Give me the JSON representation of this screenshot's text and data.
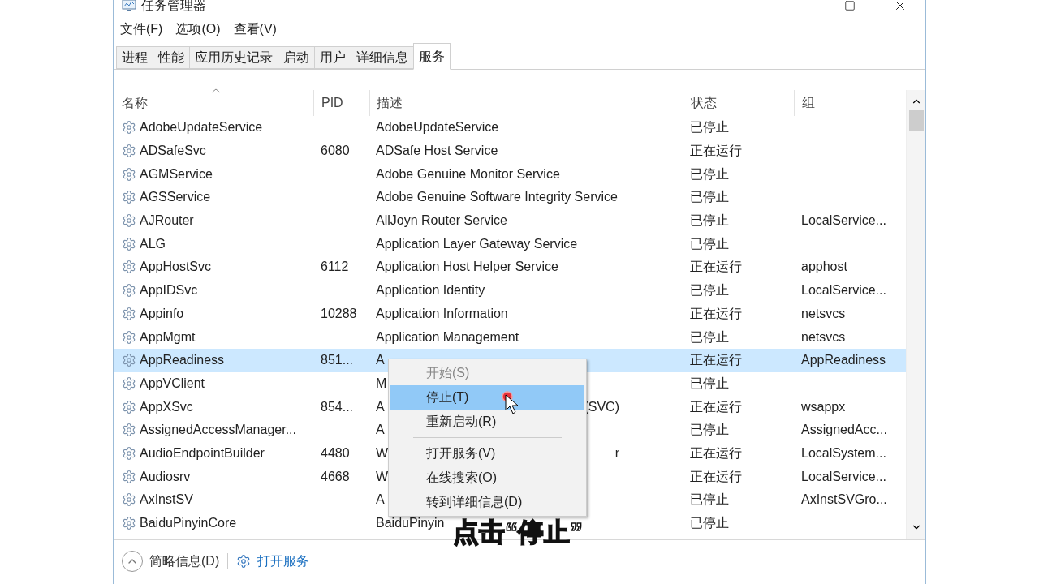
{
  "window": {
    "title": "任务管理器"
  },
  "menu": [
    "文件(F)",
    "选项(O)",
    "查看(V)"
  ],
  "tabs": [
    {
      "label": "进程",
      "selected": false
    },
    {
      "label": "性能",
      "selected": false
    },
    {
      "label": "应用历史记录",
      "selected": false
    },
    {
      "label": "启动",
      "selected": false
    },
    {
      "label": "用户",
      "selected": false
    },
    {
      "label": "详细信息",
      "selected": false
    },
    {
      "label": "服务",
      "selected": true
    }
  ],
  "table": {
    "columns": [
      "名称",
      "PID",
      "描述",
      "状态",
      "组"
    ],
    "rows": [
      {
        "name": "AdobeUpdateService",
        "pid": "",
        "desc": "AdobeUpdateService",
        "status": "已停止",
        "group": "",
        "selected": false
      },
      {
        "name": "ADSafeSvc",
        "pid": "6080",
        "desc": "ADSafe Host Service",
        "status": "正在运行",
        "group": "",
        "selected": false
      },
      {
        "name": "AGMService",
        "pid": "",
        "desc": "Adobe Genuine Monitor Service",
        "status": "已停止",
        "group": "",
        "selected": false
      },
      {
        "name": "AGSService",
        "pid": "",
        "desc": "Adobe Genuine Software Integrity Service",
        "status": "已停止",
        "group": "",
        "selected": false
      },
      {
        "name": "AJRouter",
        "pid": "",
        "desc": "AllJoyn Router Service",
        "status": "已停止",
        "group": "LocalService...",
        "selected": false
      },
      {
        "name": "ALG",
        "pid": "",
        "desc": "Application Layer Gateway Service",
        "status": "已停止",
        "group": "",
        "selected": false
      },
      {
        "name": "AppHostSvc",
        "pid": "6112",
        "desc": "Application Host Helper Service",
        "status": "正在运行",
        "group": "apphost",
        "selected": false
      },
      {
        "name": "AppIDSvc",
        "pid": "",
        "desc": "Application Identity",
        "status": "已停止",
        "group": "LocalService...",
        "selected": false
      },
      {
        "name": "Appinfo",
        "pid": "10288",
        "desc": "Application Information",
        "status": "正在运行",
        "group": "netsvcs",
        "selected": false
      },
      {
        "name": "AppMgmt",
        "pid": "",
        "desc": "Application Management",
        "status": "已停止",
        "group": "netsvcs",
        "selected": false
      },
      {
        "name": "AppReadiness",
        "pid": "851...",
        "desc": "A",
        "status": "正在运行",
        "group": "AppReadiness",
        "selected": true
      },
      {
        "name": "AppVClient",
        "pid": "",
        "desc": "M",
        "status": "已停止",
        "group": "",
        "selected": false
      },
      {
        "name": "AppXSvc",
        "pid": "854...",
        "desc": "A",
        "desc_tail": "(SVC)",
        "status": "正在运行",
        "group": "wsappx",
        "selected": false
      },
      {
        "name": "AssignedAccessManager...",
        "pid": "",
        "desc": "A",
        "status": "已停止",
        "group": "AssignedAcc...",
        "selected": false
      },
      {
        "name": "AudioEndpointBuilder",
        "pid": "4480",
        "desc": "W",
        "desc_tail": "r",
        "status": "正在运行",
        "group": "LocalSystem...",
        "selected": false
      },
      {
        "name": "Audiosrv",
        "pid": "4668",
        "desc": "W",
        "status": "正在运行",
        "group": "LocalService...",
        "selected": false
      },
      {
        "name": "AxInstSV",
        "pid": "",
        "desc": "A",
        "status": "已停止",
        "group": "AxInstSVGro...",
        "selected": false
      },
      {
        "name": "BaiduPinyinCore",
        "pid": "",
        "desc": "BaiduPinyin",
        "status": "已停止",
        "group": "",
        "selected": false
      }
    ]
  },
  "context_menu": [
    {
      "label": "开始(S)",
      "disabled": true,
      "selected": false
    },
    {
      "label": "停止(T)",
      "disabled": false,
      "selected": true
    },
    {
      "label": "重新启动(R)",
      "disabled": false,
      "selected": false,
      "separator_after": true
    },
    {
      "label": "打开服务(V)",
      "disabled": false,
      "selected": false
    },
    {
      "label": "在线搜索(O)",
      "disabled": false,
      "selected": false
    },
    {
      "label": "转到详细信息(D)",
      "disabled": false,
      "selected": false
    }
  ],
  "footer": {
    "collapse": "简略信息(D)",
    "link": "打开服务"
  },
  "caption": "点击“停止”"
}
